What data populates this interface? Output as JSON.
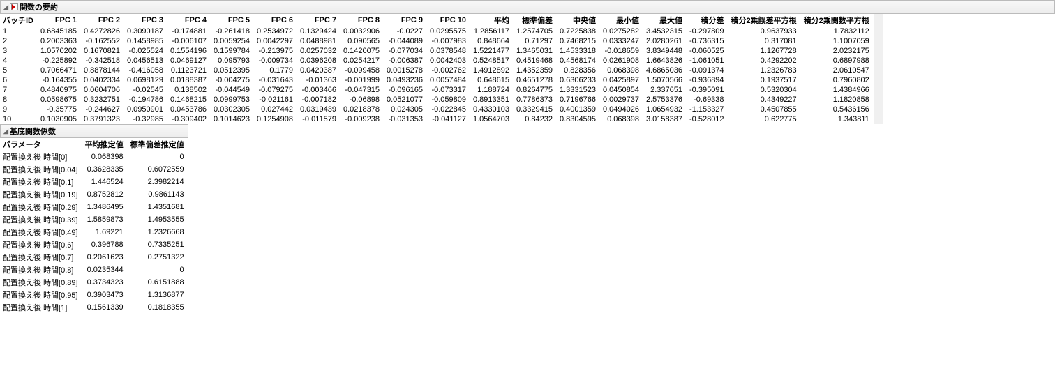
{
  "summary": {
    "title": "関数の要約",
    "headers": [
      "バッチID",
      "FPC 1",
      "FPC 2",
      "FPC 3",
      "FPC 4",
      "FPC 5",
      "FPC 6",
      "FPC 7",
      "FPC 8",
      "FPC 9",
      "FPC 10",
      "平均",
      "標準偏差",
      "中央値",
      "最小値",
      "最大値",
      "積分差",
      "積分2乗誤差平方根",
      "積分2乗関数平方根"
    ],
    "rows": [
      [
        "1",
        "0.6845185",
        "0.4272826",
        "0.3090187",
        "-0.174881",
        "-0.261418",
        "0.2534972",
        "0.1329424",
        "0.0032906",
        "-0.0227",
        "0.0295575",
        "1.2856117",
        "1.2574705",
        "0.7225838",
        "0.0275282",
        "3.4532315",
        "-0.297809",
        "0.9637933",
        "1.7832112"
      ],
      [
        "2",
        "0.2003363",
        "-0.162552",
        "0.1458985",
        "-0.006107",
        "0.0059254",
        "0.0042297",
        "0.0488981",
        "0.090565",
        "-0.044089",
        "-0.007983",
        "0.848664",
        "0.71297",
        "0.7468215",
        "0.0333247",
        "2.0280261",
        "-0.736315",
        "0.317081",
        "1.1007059"
      ],
      [
        "3",
        "1.0570202",
        "0.1670821",
        "-0.025524",
        "0.1554196",
        "0.1599784",
        "-0.213975",
        "0.0257032",
        "0.1420075",
        "-0.077034",
        "0.0378548",
        "1.5221477",
        "1.3465031",
        "1.4533318",
        "-0.018659",
        "3.8349448",
        "-0.060525",
        "1.1267728",
        "2.0232175"
      ],
      [
        "4",
        "-0.225892",
        "-0.342518",
        "0.0456513",
        "0.0469127",
        "0.095793",
        "-0.009734",
        "0.0396208",
        "0.0254217",
        "-0.006387",
        "0.0042403",
        "0.5248517",
        "0.4519468",
        "0.4568174",
        "0.0261908",
        "1.6643826",
        "-1.061051",
        "0.4292202",
        "0.6897988"
      ],
      [
        "5",
        "0.7066471",
        "0.8878144",
        "-0.416058",
        "0.1123721",
        "0.0512395",
        "0.1779",
        "0.0420387",
        "-0.099458",
        "0.0015278",
        "-0.002762",
        "1.4912892",
        "1.4352359",
        "0.828356",
        "0.068398",
        "4.6865036",
        "-0.091374",
        "1.2326783",
        "2.0610547"
      ],
      [
        "6",
        "-0.164355",
        "0.0402334",
        "0.0698129",
        "0.0188387",
        "-0.004275",
        "-0.031643",
        "-0.01363",
        "-0.001999",
        "0.0493236",
        "0.0057484",
        "0.648615",
        "0.4651278",
        "0.6306233",
        "0.0425897",
        "1.5070566",
        "-0.936894",
        "0.1937517",
        "0.7960802"
      ],
      [
        "7",
        "0.4840975",
        "0.0604706",
        "-0.02545",
        "0.138502",
        "-0.044549",
        "-0.079275",
        "-0.003466",
        "-0.047315",
        "-0.096165",
        "-0.073317",
        "1.188724",
        "0.8264775",
        "1.3331523",
        "0.0450854",
        "2.337651",
        "-0.395091",
        "0.5320304",
        "1.4384966"
      ],
      [
        "8",
        "0.0598675",
        "0.3232751",
        "-0.194786",
        "0.1468215",
        "0.0999753",
        "-0.021161",
        "-0.007182",
        "-0.06898",
        "0.0521077",
        "-0.059809",
        "0.8913351",
        "0.7786373",
        "0.7196766",
        "0.0029737",
        "2.5753376",
        "-0.69338",
        "0.4349227",
        "1.1820858"
      ],
      [
        "9",
        "-0.35775",
        "-0.244627",
        "0.0950901",
        "0.0453786",
        "0.0302305",
        "0.027442",
        "0.0319439",
        "0.0218378",
        "0.024305",
        "-0.022845",
        "0.4330103",
        "0.3329415",
        "0.4001359",
        "0.0494026",
        "1.0654932",
        "-1.153327",
        "0.4507855",
        "0.5436156"
      ],
      [
        "10",
        "0.1030905",
        "0.3791323",
        "-0.32985",
        "-0.309402",
        "0.1014623",
        "0.1254908",
        "-0.011579",
        "-0.009238",
        "-0.031353",
        "-0.041127",
        "1.0564703",
        "0.84232",
        "0.8304595",
        "0.068398",
        "3.0158387",
        "-0.528012",
        "0.622775",
        "1.343811"
      ]
    ]
  },
  "basis": {
    "title": "基底関数係数",
    "headers": [
      "パラメータ",
      "平均推定値",
      "標準偏差推定値"
    ],
    "rows": [
      [
        "配置換え後 時間[0]",
        "0.068398",
        "0"
      ],
      [
        "配置換え後 時間[0.04]",
        "0.3628335",
        "0.6072559"
      ],
      [
        "配置換え後 時間[0.1]",
        "1.446524",
        "2.3982214"
      ],
      [
        "配置換え後 時間[0.19]",
        "0.8752812",
        "0.9861143"
      ],
      [
        "配置換え後 時間[0.29]",
        "1.3486495",
        "1.4351681"
      ],
      [
        "配置換え後 時間[0.39]",
        "1.5859873",
        "1.4953555"
      ],
      [
        "配置換え後 時間[0.49]",
        "1.69221",
        "1.2326668"
      ],
      [
        "配置換え後 時間[0.6]",
        "0.396788",
        "0.7335251"
      ],
      [
        "配置換え後 時間[0.7]",
        "0.2061623",
        "0.2751322"
      ],
      [
        "配置換え後 時間[0.8]",
        "0.0235344",
        "0"
      ],
      [
        "配置換え後 時間[0.89]",
        "0.3734323",
        "0.6151888"
      ],
      [
        "配置換え後 時間[0.95]",
        "0.3903473",
        "1.3136877"
      ],
      [
        "配置換え後 時間[1]",
        "0.1561339",
        "0.1818355"
      ]
    ]
  }
}
